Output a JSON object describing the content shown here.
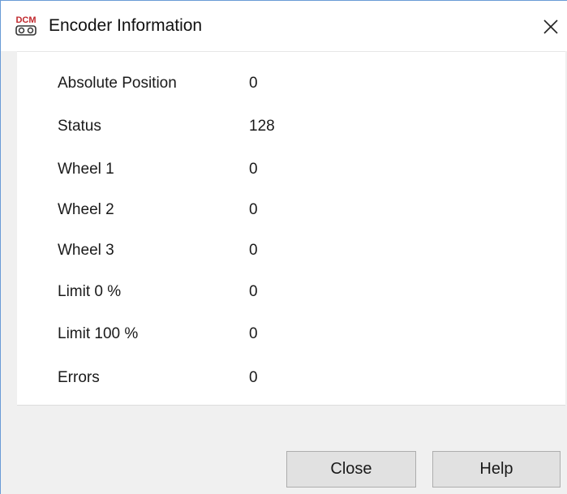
{
  "window": {
    "title": "Encoder Information",
    "app_icon_text": "DCM",
    "close_glyph": "✕"
  },
  "fields": [
    {
      "label": "Absolute Position",
      "value": "0"
    },
    {
      "label": "Status",
      "value": "128"
    },
    {
      "label": "Wheel 1",
      "value": "0"
    },
    {
      "label": "Wheel 2",
      "value": "0"
    },
    {
      "label": "Wheel 3",
      "value": "0"
    },
    {
      "label": "Limit 0 %",
      "value": "0"
    },
    {
      "label": "Limit 100 %",
      "value": "0"
    },
    {
      "label": "Errors",
      "value": "0"
    }
  ],
  "buttons": {
    "close_label": "Close",
    "help_label": "Help"
  },
  "colors": {
    "window_border": "#6a9bd6",
    "button_face": "#e1e1e1",
    "dialog_background": "#f0f0f0",
    "icon_red": "#c0282d"
  },
  "icons": {
    "app": "dcm-app-icon",
    "close": "close-icon"
  }
}
